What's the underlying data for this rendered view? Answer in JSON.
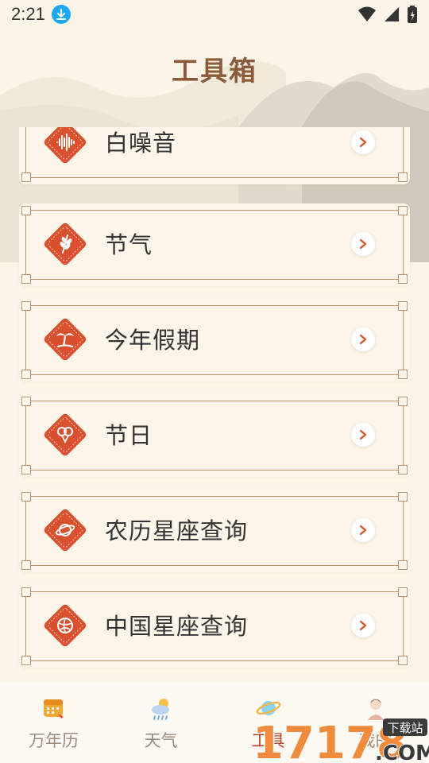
{
  "status_bar": {
    "time": "2:21"
  },
  "header": {
    "title": "工具箱"
  },
  "tools": [
    {
      "label": "白噪音",
      "icon": "sound-wave-icon"
    },
    {
      "label": "节气",
      "icon": "wheat-icon"
    },
    {
      "label": "今年假期",
      "icon": "palm-tree-icon"
    },
    {
      "label": "节日",
      "icon": "balloons-icon"
    },
    {
      "label": "农历星座查询",
      "icon": "planet-icon"
    },
    {
      "label": "中国星座查询",
      "icon": "constellation-icon"
    }
  ],
  "bottom_nav": [
    {
      "label": "万年历",
      "icon": "calendar-icon",
      "active": false
    },
    {
      "label": "天气",
      "icon": "weather-icon",
      "active": false
    },
    {
      "label": "工具",
      "icon": "tool-planet-icon",
      "active": true
    },
    {
      "label": "我的",
      "icon": "avatar-icon",
      "active": false
    }
  ],
  "watermark": {
    "number": "17178",
    "suffix": ".COM",
    "tag": "下载站"
  },
  "colors": {
    "background": "#fbf5e7",
    "accent": "#d9502e",
    "title_brown": "#8a5a3b",
    "frame": "#b99475"
  }
}
